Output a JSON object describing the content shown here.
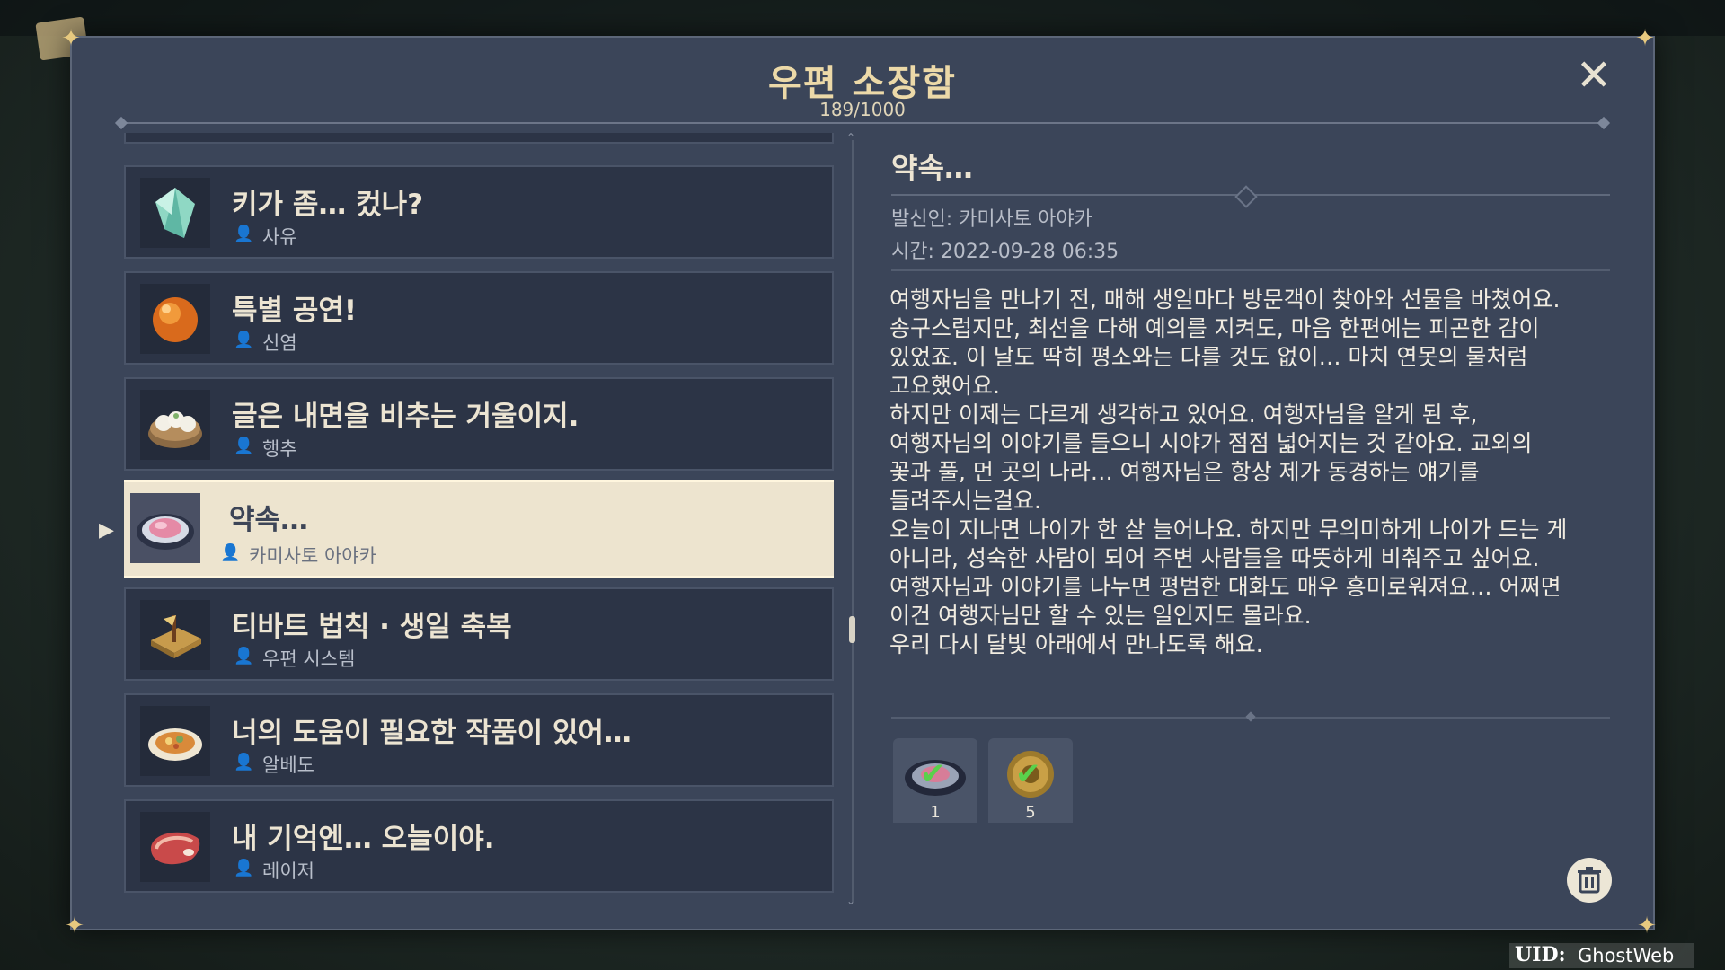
{
  "mailbox": {
    "title": "우편 소장함",
    "count": "189/1000"
  },
  "mail_list": [
    {
      "subject": "키가 좀… 컸나?",
      "sender": "사유",
      "icon": "crystal-icon",
      "selected": false
    },
    {
      "subject": "특별 공연!",
      "sender": "신염",
      "icon": "orange-gem-icon",
      "selected": false
    },
    {
      "subject": "글은 내면을 비추는 거울이지.",
      "sender": "행추",
      "icon": "dumpling-basket-icon",
      "selected": false
    },
    {
      "subject": "약속…",
      "sender": "카미사토 아야카",
      "icon": "dish-icon",
      "selected": true
    },
    {
      "subject": "티바트 법칙 · 생일 축복",
      "sender": "우편 시스템",
      "icon": "gift-box-icon",
      "selected": false
    },
    {
      "subject": "너의 도움이 필요한 작품이 있어…",
      "sender": "알베도",
      "icon": "plate-food-icon",
      "selected": false
    },
    {
      "subject": "내 기억엔… 오늘이야.",
      "sender": "레이저",
      "icon": "meat-icon",
      "selected": false
    }
  ],
  "detail": {
    "subject": "약속…",
    "sender_line": "발신인: 카미사토 아야카",
    "time_line": "시간: 2022-09-28 06:35",
    "body": [
      "여행자님을 만나기 전, 매해 생일마다 방문객이 찾아와 선물을 바쳤어요.",
      "송구스럽지만, 최선을 다해 예의를 지켜도, 마음 한편에는 피곤한 감이",
      "있었죠. 이 날도 딱히 평소와는 다를 것도 없이… 마치 연못의 물처럼",
      "고요했어요.",
      "하지만 이제는 다르게 생각하고 있어요. 여행자님을 알게 된 후,",
      "여행자님의 이야기를 들으니 시야가 점점 넓어지는 것 같아요. 교외의",
      "꽃과 풀, 먼 곳의 나라… 여행자님은 항상 제가 동경하는 얘기를",
      "들려주시는걸요.",
      "오늘이 지나면 나이가 한 살 늘어나요. 하지만 무의미하게 나이가 드는 게",
      "아니라, 성숙한 사람이 되어 주변 사람들을 따뜻하게 비춰주고 싶어요.",
      "여행자님과 이야기를 나누면 평범한 대화도 매우 흥미로워져요… 어쩌면",
      "이건 여행자님만 할 수 있는 일인지도 몰라요.",
      "우리 다시 달빛 아래에서 만나도록 해요."
    ],
    "attachments": [
      {
        "icon": "dish-icon",
        "count": "1",
        "claimed": true
      },
      {
        "icon": "mora-coin-icon",
        "count": "5",
        "claimed": true
      }
    ]
  },
  "uid": {
    "label": "UID:",
    "value": "GhostWeb"
  },
  "colors": {
    "panel": "#3b4559",
    "title_gold": "#ecd9a8",
    "selected_bg": "#ede4cf"
  }
}
